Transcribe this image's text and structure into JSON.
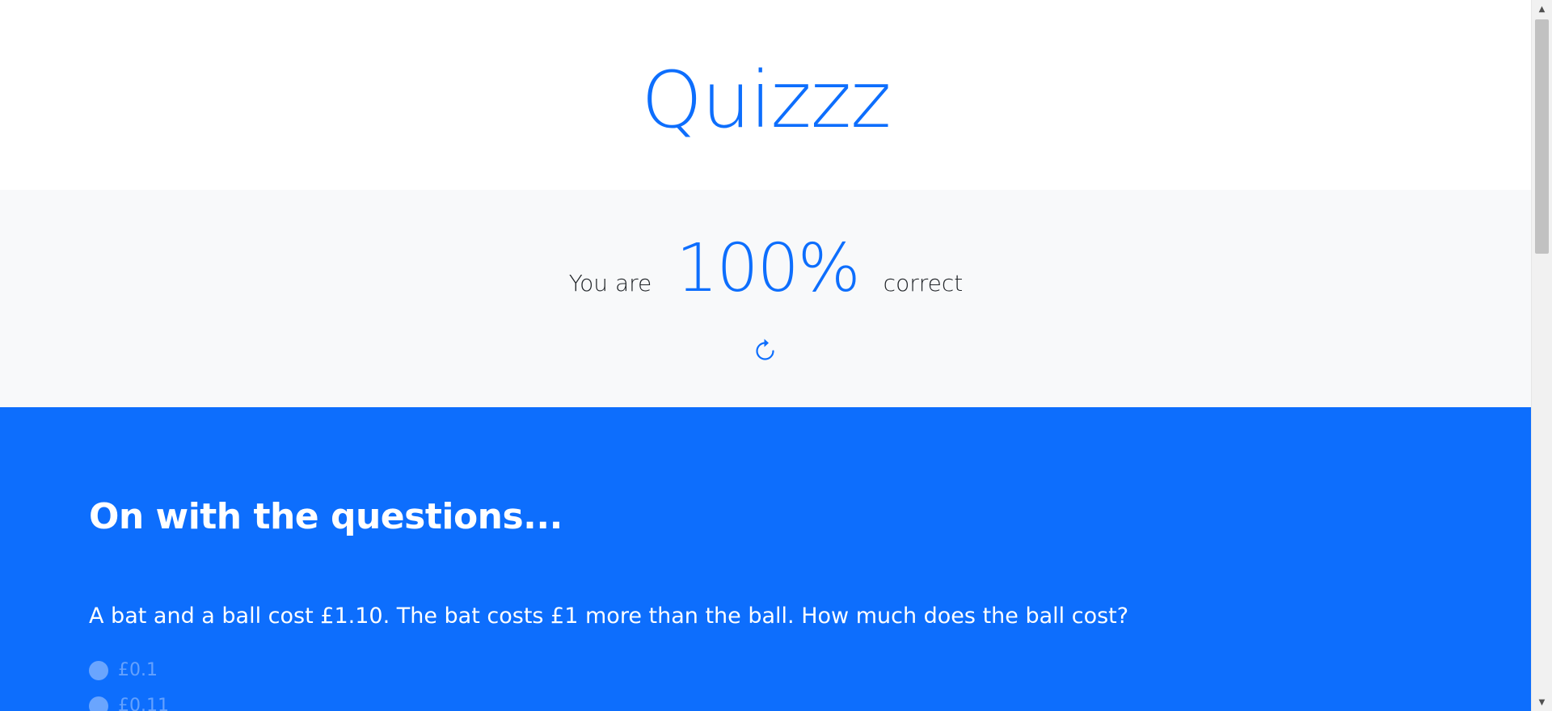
{
  "header": {
    "title": "Quizzz"
  },
  "score": {
    "prefix": "You are",
    "value": "100%",
    "suffix": "correct",
    "retry_icon": "refresh-icon"
  },
  "questions": {
    "heading": "On with the questions...",
    "items": [
      {
        "text": "A bat and a ball cost £1.10. The bat costs £1 more than the ball. How much does the ball cost?",
        "options": [
          {
            "label": "£0.1"
          },
          {
            "label": "£0.11"
          }
        ]
      }
    ]
  },
  "colors": {
    "primary": "#0d6efd",
    "light_bg": "#f8f9fa",
    "text_dark": "#212529",
    "white": "#ffffff"
  }
}
